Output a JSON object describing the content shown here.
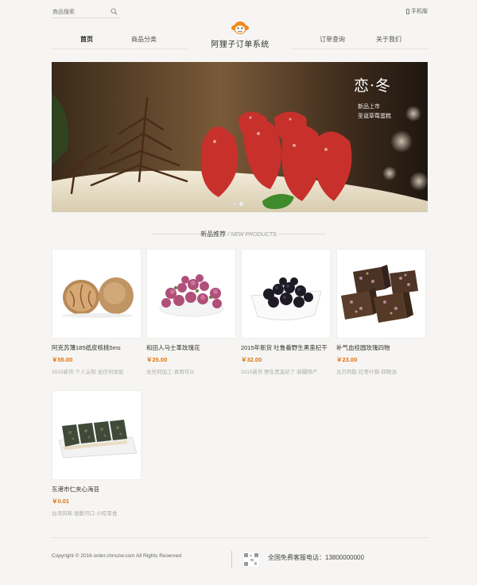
{
  "header": {
    "search_placeholder": "商品搜索",
    "mobile_label": "手机版",
    "brand": "阿狸子订单系统"
  },
  "nav": [
    {
      "label": "首页",
      "active": true
    },
    {
      "label": "商品分类"
    },
    {
      "label": "订单查询"
    },
    {
      "label": "关于我们"
    }
  ],
  "banner": {
    "title": "恋·冬",
    "line1": "新品上市",
    "line2": "圣诞草莓蛋糕"
  },
  "section": {
    "title_cn": "新品推荐",
    "title_en": "NEW PRODUCTS"
  },
  "products": [
    {
      "name": "阿克苏薄185纸皮核桃5ms",
      "price": "￥55.00",
      "desc": "2015新货·个人认知·无任何添加",
      "icon": "walnut-image"
    },
    {
      "name": "和田人马士革玫瑰花",
      "price": "￥25.00",
      "desc": "无任何加工·食用可以",
      "icon": "rose-tea-image"
    },
    {
      "name": "2015年新货 吐鲁番野生黑蛮杞干",
      "price": "￥32.00",
      "desc": "2015新货 野生黑蛮杞了·新疆特产",
      "icon": "goji-image"
    },
    {
      "name": "补气血桂圆玫瑰四物",
      "price": "￥23.00",
      "desc": "古方阿胶·红枣什锦·四物汤",
      "icon": "brown-sugar-image"
    },
    {
      "name": "东港市仁夹心海苔",
      "price": "￥0.01",
      "desc": "台湾风味·香脆可口·小吃零食",
      "icon": "seaweed-image"
    }
  ],
  "footer": {
    "copyright": "Copyright © 2016 order.chnszw.com All Rights Reserved",
    "hotline": "全国免费客服电话：13800000000"
  },
  "colors": {
    "accent": "#e0720e",
    "background": "#f6f5f3"
  }
}
